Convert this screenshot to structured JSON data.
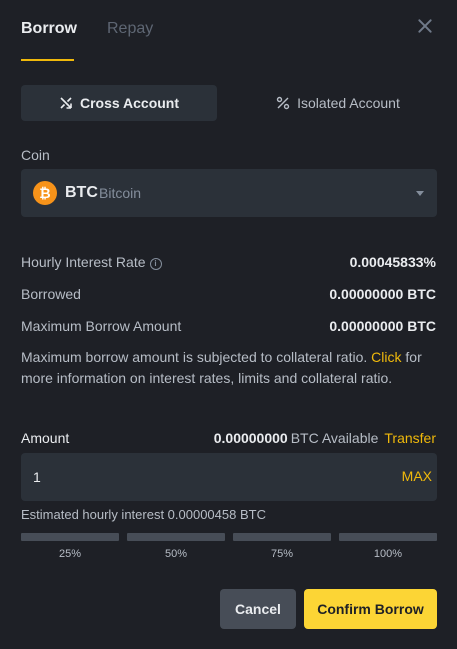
{
  "tabs": {
    "borrow": "Borrow",
    "repay": "Repay"
  },
  "accounts": {
    "cross": "Cross Account",
    "isolated": "Isolated Account"
  },
  "coin": {
    "label": "Coin",
    "symbol": "BTC",
    "name": "Bitcoin",
    "icon_glyph": "₿"
  },
  "rows": {
    "hourly_rate_label": "Hourly Interest Rate",
    "hourly_rate_value": "0.00045833%",
    "borrowed_label": "Borrowed",
    "borrowed_value": "0.00000000 BTC",
    "max_label": "Maximum Borrow Amount",
    "max_value": "0.00000000 BTC"
  },
  "note": {
    "before": "Maximum borrow amount is subjected to collateral ratio. ",
    "link": "Click",
    "after": " for more information on interest rates, limits and collateral ratio."
  },
  "amount": {
    "label": "Amount",
    "available_number": "0.00000000",
    "available_text": "BTC Available",
    "transfer": "Transfer",
    "value": "1",
    "max": "MAX"
  },
  "estimate": "Estimated hourly interest 0.00000458 BTC",
  "percent_options": [
    "25%",
    "50%",
    "75%",
    "100%"
  ],
  "buttons": {
    "cancel": "Cancel",
    "confirm": "Confirm Borrow"
  },
  "colors": {
    "accent": "#f0b90b",
    "confirm": "#fcd535",
    "background": "#1e2026",
    "field": "#2b3139"
  }
}
